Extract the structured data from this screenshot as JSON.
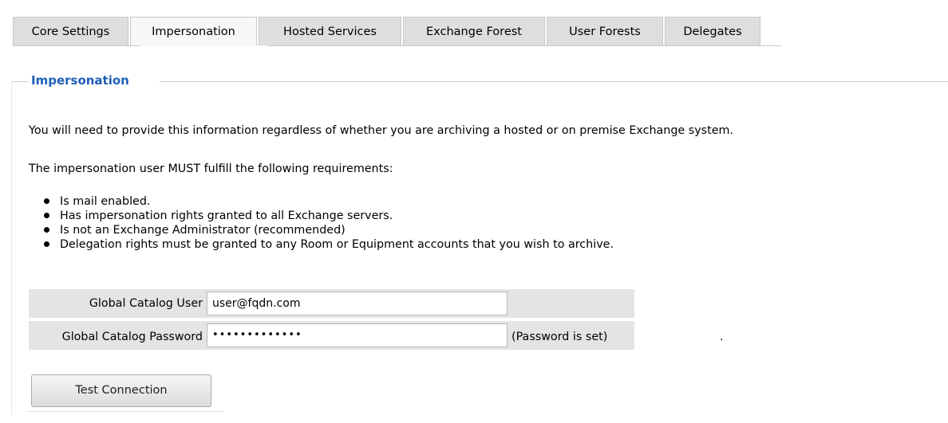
{
  "tabs": [
    {
      "label": "Core Settings",
      "active": false
    },
    {
      "label": "Impersonation",
      "active": true
    },
    {
      "label": "Hosted Services",
      "active": false
    },
    {
      "label": "Exchange Forest",
      "active": false
    },
    {
      "label": "User Forests",
      "active": false
    },
    {
      "label": "Delegates",
      "active": false
    }
  ],
  "section": {
    "legend": "Impersonation",
    "intro": "You will need to provide this information regardless of whether you are archiving a hosted or on premise Exchange system.",
    "requirements_heading": "The impersonation user MUST fulfill the following requirements:",
    "requirements": [
      "Is mail enabled.",
      "Has impersonation rights granted to all Exchange servers.",
      "Is not an Exchange Administrator (recommended)",
      "Delegation rights must be granted to any Room or Equipment accounts that you wish to archive."
    ]
  },
  "form": {
    "user_label": "Global Catalog User",
    "user_value": "user@fqdn.com",
    "password_label": "Global Catalog Password",
    "password_value": "•••••••••••••",
    "password_note": "(Password is set)",
    "trailing_mark": "."
  },
  "actions": {
    "test_connection_label": "Test Connection"
  },
  "colors": {
    "legend": "#1f5fb8",
    "tab_inactive": "#dedede",
    "tab_active": "#f7f7f7",
    "form_row": "#e4e4e4"
  }
}
